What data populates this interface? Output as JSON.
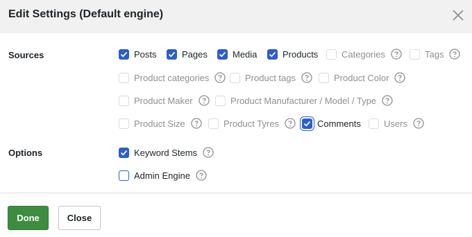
{
  "dialog": {
    "title": "Edit Settings (Default engine)",
    "close_icon": "close-icon"
  },
  "sources": {
    "label": "Sources",
    "items": [
      {
        "label": "Posts",
        "checked": true,
        "disabled": false
      },
      {
        "label": "Pages",
        "checked": true,
        "disabled": false
      },
      {
        "label": "Media",
        "checked": true,
        "disabled": false
      },
      {
        "label": "Products",
        "checked": true,
        "disabled": false
      },
      {
        "label": "Categories",
        "checked": false,
        "disabled": true,
        "help": true
      },
      {
        "label": "Tags",
        "checked": false,
        "disabled": true,
        "help": true
      },
      {
        "label": "Product categories",
        "checked": false,
        "disabled": true,
        "help": true
      },
      {
        "label": "Product tags",
        "checked": false,
        "disabled": true,
        "help": true
      },
      {
        "label": "Product Color",
        "checked": false,
        "disabled": true,
        "help": true
      },
      {
        "label": "Product Maker",
        "checked": false,
        "disabled": true,
        "help": true
      },
      {
        "label": "Product Manufacturer / Model / Type",
        "checked": false,
        "disabled": true,
        "help": true
      },
      {
        "label": "Product Size",
        "checked": false,
        "disabled": true,
        "help": true
      },
      {
        "label": "Product Tyres",
        "checked": false,
        "disabled": true,
        "help": true
      },
      {
        "label": "Comments",
        "checked": true,
        "disabled": false,
        "focused": true
      },
      {
        "label": "Users",
        "checked": false,
        "disabled": true,
        "help": true
      }
    ]
  },
  "options": {
    "label": "Options",
    "items": [
      {
        "label": "Keyword Stems",
        "checked": true,
        "help": true
      },
      {
        "label": "Admin Engine",
        "checked": false,
        "help": true
      }
    ]
  },
  "footer": {
    "done_label": "Done",
    "close_label": "Close"
  },
  "colors": {
    "accent": "#2c5dcf",
    "done_button": "#3d8c40",
    "header_bg": "#f1f1f1",
    "disabled_text": "#8c8f94"
  }
}
